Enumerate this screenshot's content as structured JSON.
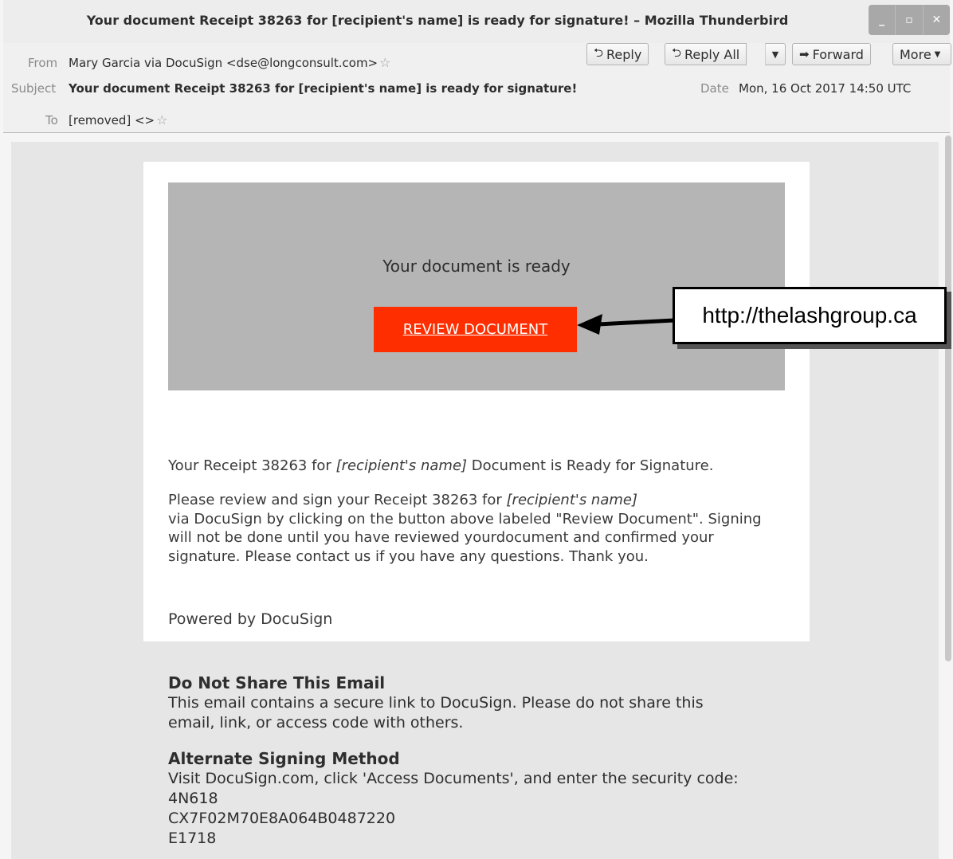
{
  "window": {
    "title": "Your document Receipt 38263 for [recipient's name] is ready for signature! – Mozilla Thunderbird",
    "min_glyph": "_",
    "max_glyph": "▫",
    "close_glyph": "✕"
  },
  "header": {
    "from_label": "From",
    "from_value": "Mary Garcia via DocuSign <dse@longconsult.com>",
    "subject_label": "Subject",
    "subject_value": "Your document Receipt 38263 for [recipient's name] is ready for signature!",
    "to_label": "To",
    "to_value": "[removed] <>",
    "date_label": "Date",
    "date_value": "Mon, 16 Oct 2017 14:50 UTC",
    "star_glyph": "☆",
    "buttons": {
      "reply": "Reply",
      "reply_all": "Reply All",
      "forward": "Forward",
      "more": "More"
    },
    "icons": {
      "reply": "⮌",
      "reply_all": "⮌",
      "forward": "➡",
      "dropdown": "▼"
    }
  },
  "email": {
    "banner_text": "Your document is ready",
    "review_button": "REVIEW DOCUMENT",
    "p1_a": "Your Receipt 38263 for ",
    "p1_em": "[recipient's name]",
    "p1_b": " Document is Ready for Signature.",
    "p2_a": "Please review and sign your Receipt 38263 for ",
    "p2_em": "[recipient's name]",
    "p2_b": "via DocuSign by clicking on the button above labeled \"Review Document\". Signing will not be done until you have reviewed yourdocument and confirmed your signature. Please contact us if you have any questions. Thank you.",
    "powered": "Powered by DocuSign",
    "share_heading": "Do Not Share This Email",
    "share_text": "This email contains a secure link to DocuSign. Please do not share this email, link, or access code with others.",
    "alt_heading": "Alternate Signing Method",
    "alt_text": "Visit DocuSign.com, click 'Access Documents', and enter the security code:",
    "code_1": "4N618",
    "code_2": "CX7F02M70E8A064B0487220",
    "code_3": "E1718"
  },
  "callout": {
    "url": "http://thelashgroup.ca"
  }
}
